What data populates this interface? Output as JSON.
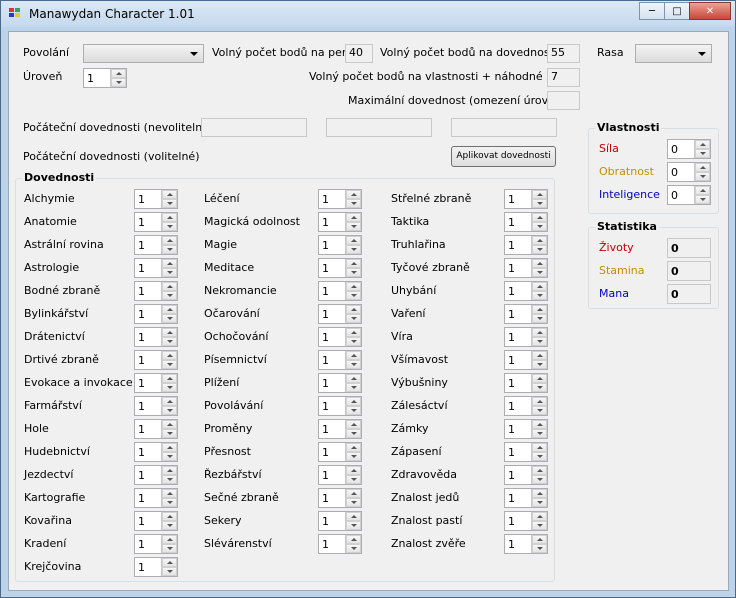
{
  "window": {
    "title": "Manawydan Character 1.01",
    "buttons": [
      "minimize",
      "maximize",
      "close"
    ]
  },
  "top": {
    "povolani_label": "Povolání",
    "povolani_value": "",
    "uroven_label": "Úroveň",
    "uroven_value": "1",
    "perky_label": "Volný počet bodů na perky",
    "perky_value": "40",
    "dovednosti_label": "Volný počet bodů na dovednosti",
    "dovednosti_value": "55",
    "rasa_label": "Rasa",
    "rasa_value": "",
    "vlastnosti_label": "Volný počet bodů na vlastnosti + náhodné body",
    "vlastnosti_value": "7",
    "max_label": "Maximální dovednost (omezení úrovní)",
    "max_value": "",
    "pocatecni_nevol_label": "Počáteční dovednosti (nevolitelné)",
    "pocatecni_nevol_values": [
      "",
      "",
      ""
    ],
    "pocatecni_vol_label": "Počáteční dovednosti (volitelné)",
    "apply_button": "Aplikovat dovednosti"
  },
  "skills": {
    "title": "Dovednosti",
    "columns": [
      [
        {
          "name": "Alchymie",
          "value": "1"
        },
        {
          "name": "Anatomie",
          "value": "1"
        },
        {
          "name": "Astrální rovina",
          "value": "1"
        },
        {
          "name": "Astrologie",
          "value": "1"
        },
        {
          "name": "Bodné zbraně",
          "value": "1"
        },
        {
          "name": "Bylinkářství",
          "value": "1"
        },
        {
          "name": "Drátenictví",
          "value": "1"
        },
        {
          "name": "Drtivé zbraně",
          "value": "1"
        },
        {
          "name": "Evokace a invokace",
          "value": "1"
        },
        {
          "name": "Farmářství",
          "value": "1"
        },
        {
          "name": "Hole",
          "value": "1"
        },
        {
          "name": "Hudebnictví",
          "value": "1"
        },
        {
          "name": "Jezdectví",
          "value": "1"
        },
        {
          "name": "Kartografie",
          "value": "1"
        },
        {
          "name": "Kovařina",
          "value": "1"
        },
        {
          "name": "Kradení",
          "value": "1"
        },
        {
          "name": "Krejčovina",
          "value": "1"
        }
      ],
      [
        {
          "name": "Léčení",
          "value": "1"
        },
        {
          "name": "Magická odolnost",
          "value": "1"
        },
        {
          "name": "Magie",
          "value": "1"
        },
        {
          "name": "Meditace",
          "value": "1"
        },
        {
          "name": "Nekromancie",
          "value": "1"
        },
        {
          "name": "Očarování",
          "value": "1"
        },
        {
          "name": "Ochočování",
          "value": "1"
        },
        {
          "name": "Písemnictví",
          "value": "1"
        },
        {
          "name": "Plížení",
          "value": "1"
        },
        {
          "name": "Povolávání",
          "value": "1"
        },
        {
          "name": "Proměny",
          "value": "1"
        },
        {
          "name": "Přesnost",
          "value": "1"
        },
        {
          "name": "Řezbářství",
          "value": "1"
        },
        {
          "name": "Sečné zbraně",
          "value": "1"
        },
        {
          "name": "Sekery",
          "value": "1"
        },
        {
          "name": "Slévárenství",
          "value": "1"
        }
      ],
      [
        {
          "name": "Střelné zbraně",
          "value": "1"
        },
        {
          "name": "Taktika",
          "value": "1"
        },
        {
          "name": "Truhlařina",
          "value": "1"
        },
        {
          "name": "Tyčové zbraně",
          "value": "1"
        },
        {
          "name": "Uhybání",
          "value": "1"
        },
        {
          "name": "Vaření",
          "value": "1"
        },
        {
          "name": "Víra",
          "value": "1"
        },
        {
          "name": "Všímavost",
          "value": "1"
        },
        {
          "name": "Výbušniny",
          "value": "1"
        },
        {
          "name": "Zálesáctví",
          "value": "1"
        },
        {
          "name": "Zámky",
          "value": "1"
        },
        {
          "name": "Zápasení",
          "value": "1"
        },
        {
          "name": "Zdravověda",
          "value": "1"
        },
        {
          "name": "Znalost jedů",
          "value": "1"
        },
        {
          "name": "Znalost pastí",
          "value": "1"
        },
        {
          "name": "Znalost zvěře",
          "value": "1"
        }
      ]
    ]
  },
  "vlastnosti": {
    "title": "Vlastnosti",
    "items": [
      {
        "name": "Síla",
        "value": "0",
        "color": "#c00000"
      },
      {
        "name": "Obratnost",
        "value": "0",
        "color": "#c09000"
      },
      {
        "name": "Inteligence",
        "value": "0",
        "color": "#0000c0"
      }
    ]
  },
  "statistika": {
    "title": "Statistika",
    "items": [
      {
        "name": "Životy",
        "value": "0",
        "color": "#c00000"
      },
      {
        "name": "Stamina",
        "value": "0",
        "color": "#c09000"
      },
      {
        "name": "Mana",
        "value": "0",
        "color": "#0000c0"
      }
    ]
  }
}
